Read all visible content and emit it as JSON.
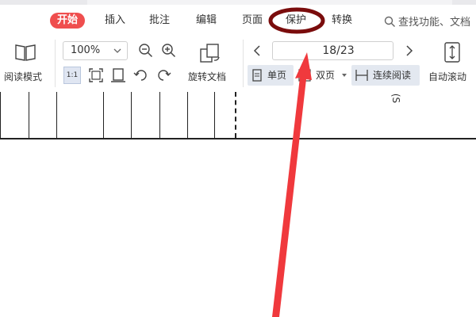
{
  "menu": {
    "tabs": [
      {
        "label": "开始",
        "active": true
      },
      {
        "label": "插入"
      },
      {
        "label": "批注"
      },
      {
        "label": "编辑"
      },
      {
        "label": "页面"
      },
      {
        "label": "保护"
      },
      {
        "label": "转换"
      }
    ],
    "search_text": "查找功能、文档"
  },
  "ribbon": {
    "read_mode_label": "阅读模式",
    "zoom_value": "100%",
    "actual_size_label": "1:1",
    "rotate_doc_label": "旋转文档",
    "page_indicator": "18/23",
    "single_page_label": "单页",
    "double_page_label": "双页",
    "continuous_label": "连续阅读",
    "auto_scroll_label": "自动滚动"
  },
  "document": {
    "side_text": "(S"
  },
  "colors": {
    "active_tab_bg": "#ef4e4e",
    "annotation_arrow": "#f0393d",
    "annotation_circle": "#7a0c0c"
  }
}
